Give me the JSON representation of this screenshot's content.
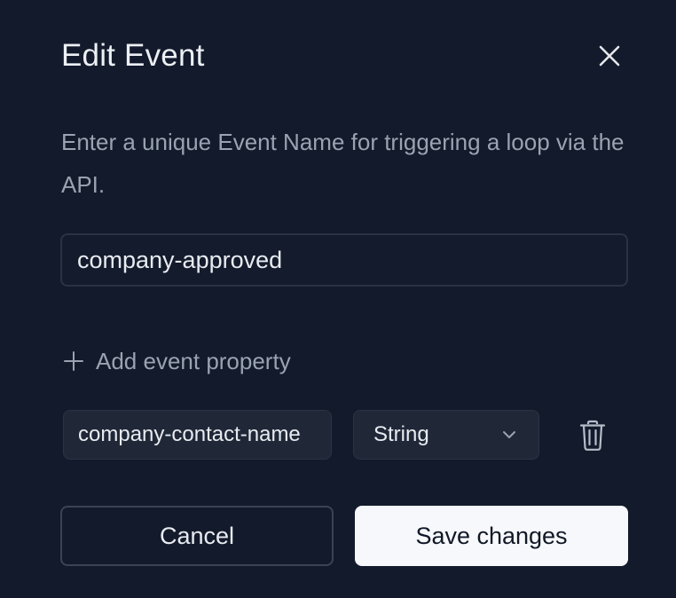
{
  "dialog": {
    "title": "Edit Event",
    "description": "Enter a unique Event Name for triggering a loop via the API.",
    "event_name_value": "company-approved",
    "add_property_label": "Add event property",
    "properties": [
      {
        "name": "company-contact-name",
        "type": "String"
      }
    ],
    "cancel_label": "Cancel",
    "save_label": "Save changes"
  },
  "icons": {
    "close": "close-icon",
    "add": "plus-icon",
    "dropdown": "chevron-down-icon",
    "delete": "trash-icon"
  },
  "colors": {
    "background": "#131a2b",
    "primary_button": "#f6f8fb",
    "muted_text": "#9aa3b2"
  }
}
